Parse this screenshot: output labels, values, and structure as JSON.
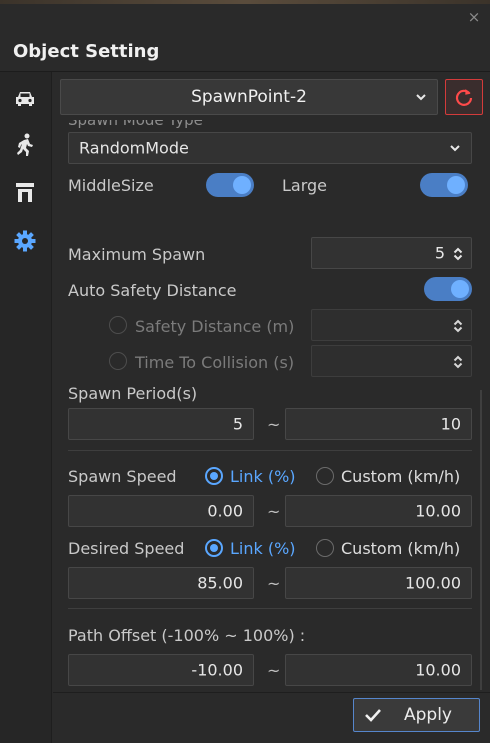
{
  "window": {
    "title": "Object Setting",
    "close_glyph": "×"
  },
  "sidebar": {
    "icons": [
      "car-icon",
      "walker-icon",
      "spawner-icon",
      "gear-icon"
    ],
    "active_color": "#5aa7ff"
  },
  "object_select": {
    "value": "SpawnPoint-2"
  },
  "mode_select": {
    "clipped_label": "Spawn Mode Type",
    "value": "RandomMode"
  },
  "size": {
    "middle_label": "MiddleSize",
    "large_label": "Large"
  },
  "maximum_spawn": {
    "label": "Maximum Spawn",
    "value": "5"
  },
  "auto_safety": {
    "label": "Auto Safety Distance"
  },
  "safety_distance": {
    "label": "Safety Distance (m)"
  },
  "time_to_collision": {
    "label": "Time To Collision (s)"
  },
  "spawn_period": {
    "label": "Spawn Period(s)",
    "min": "5",
    "max": "10",
    "separator": "~"
  },
  "spawn_speed": {
    "label": "Spawn Speed",
    "option_link": "Link (%)",
    "option_custom": "Custom (km/h)",
    "min": "0.00",
    "max": "10.00",
    "separator": "~"
  },
  "desired_speed": {
    "label": "Desired Speed",
    "option_link": "Link (%)",
    "option_custom": "Custom (km/h)",
    "min": "85.00",
    "max": "100.00",
    "separator": "~"
  },
  "path_offset": {
    "label": "Path Offset (-100% ~ 100%) :",
    "min": "-10.00",
    "max": "10.00",
    "separator": "~"
  },
  "footer": {
    "apply_label": "Apply"
  },
  "colors": {
    "accent": "#5aa7ff",
    "toggle": "#4a7ec5",
    "danger": "#d33b3b",
    "bg": "#2a2a2a"
  }
}
